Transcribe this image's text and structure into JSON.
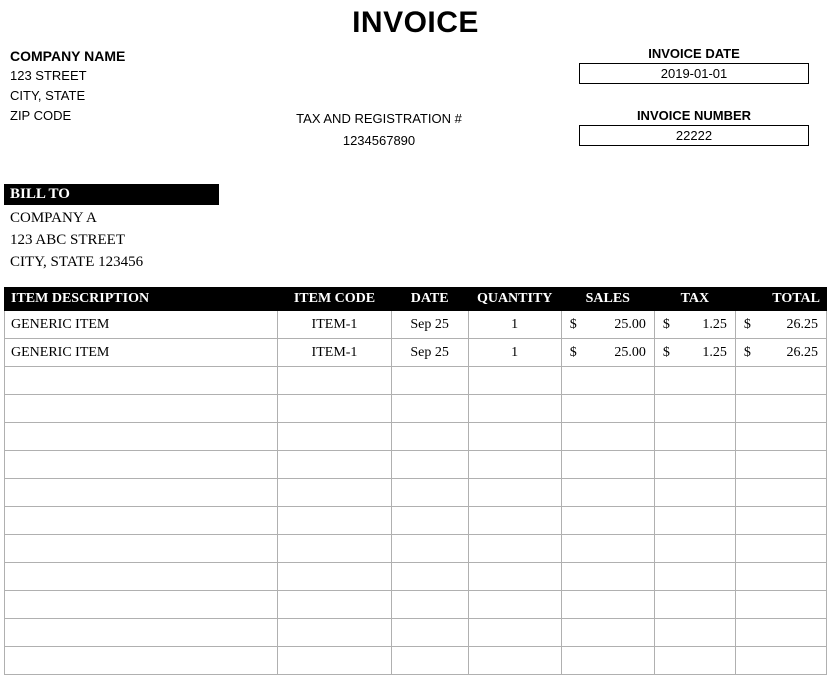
{
  "title": "INVOICE",
  "company": {
    "name": "COMPANY NAME",
    "street": "123 STREET",
    "city_state": "CITY, STATE",
    "zip": "ZIP CODE"
  },
  "tax": {
    "label": "TAX AND REGISTRATION #",
    "value": "1234567890"
  },
  "meta": {
    "date_label": "INVOICE DATE",
    "date_value": "2019-01-01",
    "number_label": "INVOICE NUMBER",
    "number_value": "22222"
  },
  "bill_to": {
    "label": "BILL TO",
    "name": "COMPANY A",
    "street": "123 ABC STREET",
    "city": "CITY, STATE 123456"
  },
  "columns": {
    "desc": "ITEM DESCRIPTION",
    "code": "ITEM CODE",
    "date": "DATE",
    "qty": "QUANTITY",
    "sales": "SALES",
    "tax": "TAX",
    "total": "TOTAL"
  },
  "currency": "$",
  "rows": [
    {
      "desc": "GENERIC ITEM",
      "code": "ITEM-1",
      "date": "Sep 25",
      "qty": "1",
      "sales": "25.00",
      "tax": "1.25",
      "total": "26.25"
    },
    {
      "desc": "GENERIC ITEM",
      "code": "ITEM-1",
      "date": "Sep 25",
      "qty": "1",
      "sales": "25.00",
      "tax": "1.25",
      "total": "26.25"
    }
  ],
  "empty_rows": 11
}
